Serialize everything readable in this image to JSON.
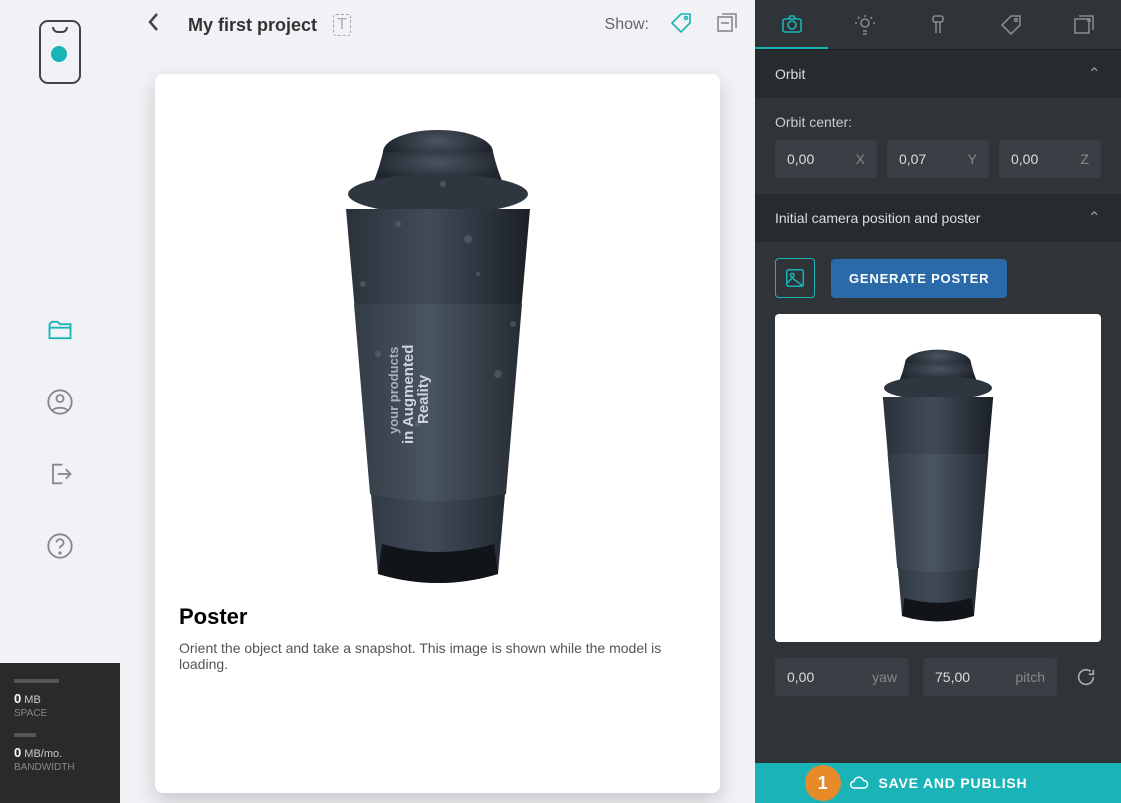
{
  "sidebar": {
    "footer": {
      "space_value": "0",
      "space_unit": "MB",
      "space_label": "SPACE",
      "bw_value": "0",
      "bw_unit": "MB/mo.",
      "bw_label": "BANDWIDTH"
    }
  },
  "header": {
    "project_title": "My first project",
    "show_label": "Show:"
  },
  "card": {
    "title": "Poster",
    "description": "Orient the object and take a snapshot. This image is shown while the model is loading."
  },
  "panel": {
    "section1_title": "Orbit",
    "orbit_center_label": "Orbit center:",
    "orbit_x": "0,00",
    "orbit_x_label": "X",
    "orbit_y": "0,07",
    "orbit_y_label": "Y",
    "orbit_z": "0,00",
    "orbit_z_label": "Z",
    "section2_title": "Initial camera position and poster",
    "gen_poster_btn": "GENERATE POSTER",
    "yaw_value": "0,00",
    "yaw_label": "yaw",
    "pitch_value": "75,00",
    "pitch_label": "pitch",
    "publish_label": "SAVE AND PUBLISH",
    "badge": "1"
  }
}
